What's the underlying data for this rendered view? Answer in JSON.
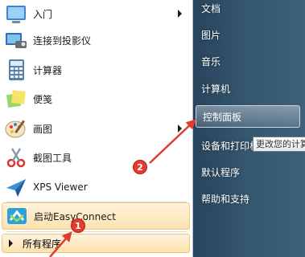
{
  "start_menu": {
    "programs": [
      {
        "label": "入门",
        "icon": "getting-started-icon",
        "has_submenu": true
      },
      {
        "label": "连接到投影仪",
        "icon": "projector-icon",
        "has_submenu": false
      },
      {
        "label": "计算器",
        "icon": "calculator-icon",
        "has_submenu": false
      },
      {
        "label": "便笺",
        "icon": "sticky-notes-icon",
        "has_submenu": false
      },
      {
        "label": "画图",
        "icon": "paint-icon",
        "has_submenu": true
      },
      {
        "label": "截图工具",
        "icon": "snipping-tool-icon",
        "has_submenu": false
      },
      {
        "label": "XPS Viewer",
        "icon": "xps-viewer-icon",
        "has_submenu": false
      },
      {
        "label": "启动EasyConnect",
        "icon": "easyconnect-icon",
        "has_submenu": false
      }
    ],
    "all_programs_label": "所有程序",
    "right_items": {
      "documents": "文档",
      "pictures": "图片",
      "music": "音乐",
      "computer": "计算机",
      "control_panel": "控制面板",
      "devices_printers": "设备和打印机",
      "default_programs": "默认程序",
      "help_support": "帮助和支持"
    },
    "tooltip": "更改您的计算机设置"
  },
  "annotations": {
    "step1": "1",
    "step2": "2",
    "color": "#e33b2e"
  }
}
